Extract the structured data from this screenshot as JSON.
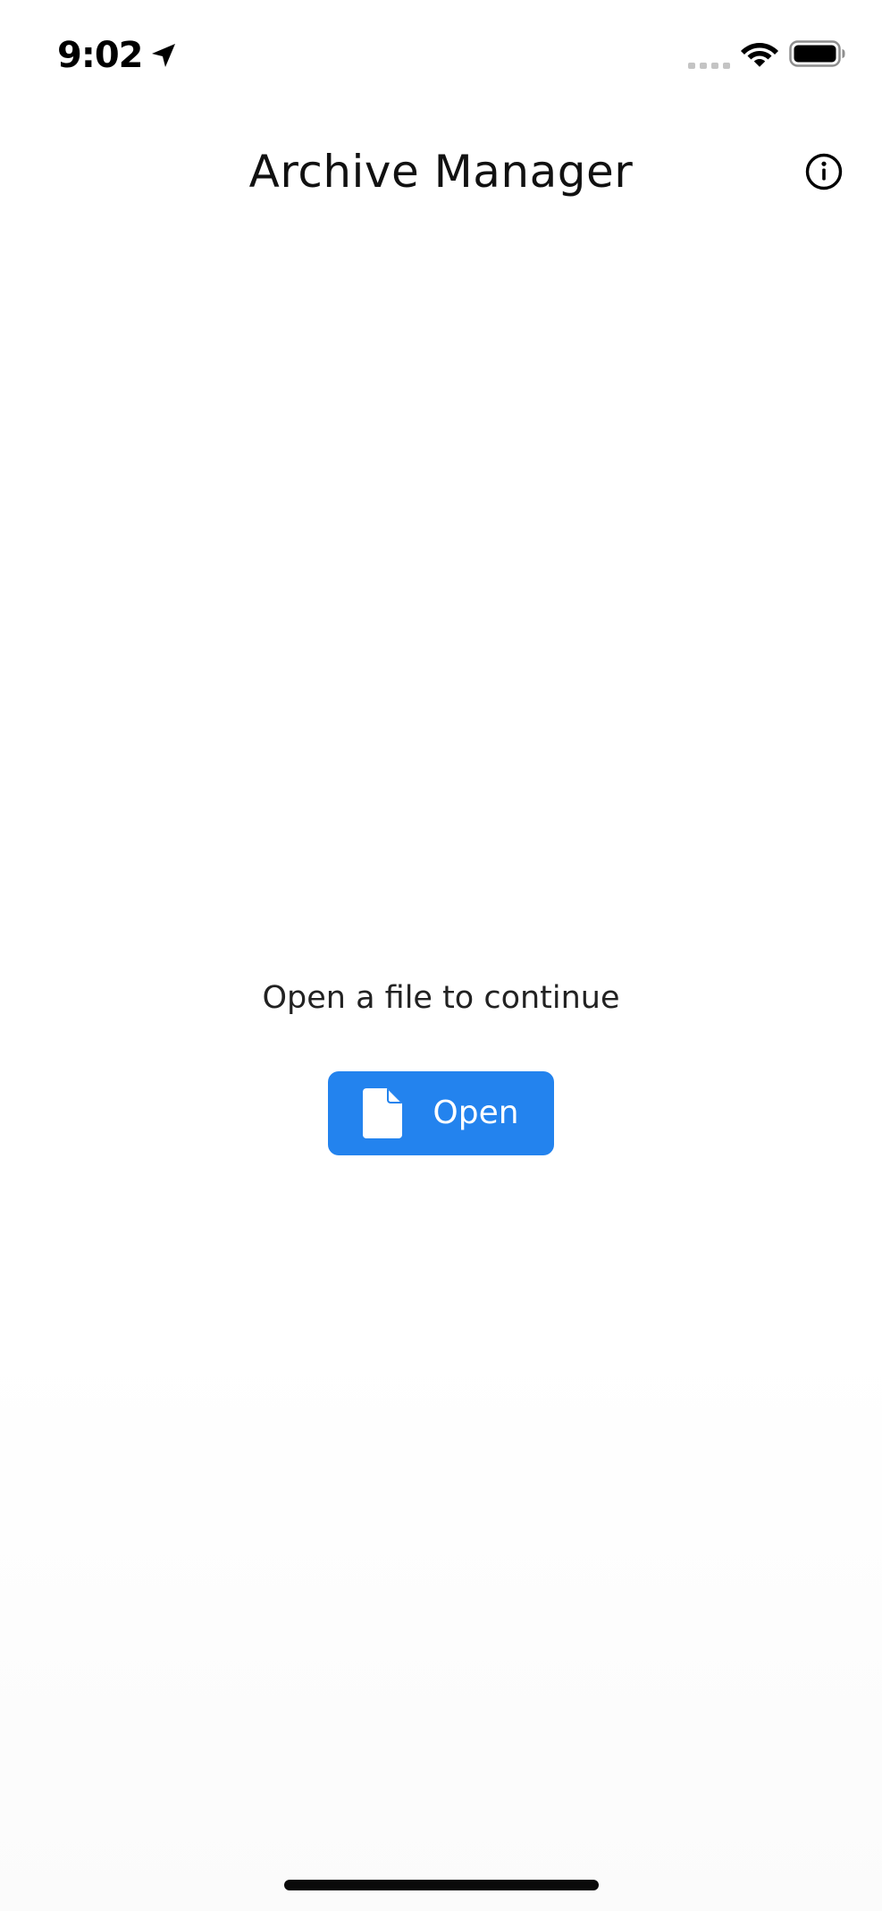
{
  "status_bar": {
    "time": "9:02",
    "icons": [
      "location-arrow-icon",
      "cellular-signal-icon",
      "wifi-icon",
      "battery-icon"
    ]
  },
  "nav_bar": {
    "title": "Archive Manager",
    "info_icon": "info-circle-icon"
  },
  "empty_state": {
    "message": "Open a file to continue",
    "open_button": {
      "label": "Open",
      "icon": "file-icon"
    }
  },
  "colors": {
    "accent": "#2383ee",
    "background": "#ffffff",
    "text": "#1a1a1a"
  }
}
